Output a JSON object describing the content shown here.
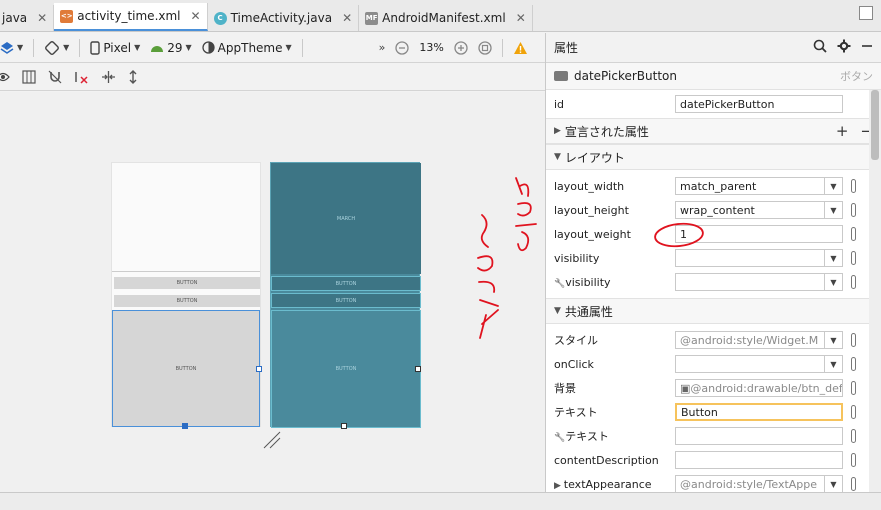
{
  "tabs": [
    {
      "label": "java",
      "icon": "java-file-icon"
    },
    {
      "label": "activity_time.xml",
      "icon": "xml-file-icon",
      "icon_text": "<>"
    },
    {
      "label": "TimeActivity.java",
      "icon": "java-class-icon",
      "icon_text": "C"
    },
    {
      "label": "AndroidManifest.xml",
      "icon": "manifest-file-icon",
      "icon_text": "MF"
    }
  ],
  "toolbar": {
    "device": "Pixel",
    "api": "29",
    "theme": "AppTheme",
    "overflow": "»",
    "zoom": "13%"
  },
  "canvas": {
    "screen1": {
      "button1": "BUTTON",
      "button2": "BUTTON",
      "button3": "BUTTON"
    },
    "screen2": {
      "top_label": "MARCH",
      "button1": "BUTTON",
      "button2": "BUTTON",
      "button3": "BUTTON"
    }
  },
  "props": {
    "title": "属性",
    "component": "datePickerButton",
    "component_kind": "ボタン",
    "id_label": "id",
    "id_value": "datePickerButton",
    "sections": {
      "declared": "宣言された属性",
      "layout": "レイアウト",
      "common": "共通属性"
    },
    "layout_rows": [
      {
        "label": "layout_width",
        "value": "match_parent",
        "dropdown": true
      },
      {
        "label": "layout_height",
        "value": "wrap_content",
        "dropdown": true
      },
      {
        "label": "layout_weight",
        "value": "1",
        "dropdown": false
      },
      {
        "label": "visibility",
        "value": "",
        "dropdown": true
      },
      {
        "label": "visibility",
        "value": "",
        "dropdown": true,
        "wrench": true
      }
    ],
    "common_rows": [
      {
        "label": "スタイル",
        "value": "@android:style/Widget.M",
        "dropdown": true,
        "gray": true
      },
      {
        "label": "onClick",
        "value": "",
        "dropdown": true
      },
      {
        "label": "背景",
        "value": "@android:drawable/btn_def",
        "dropdown": false,
        "gray": true,
        "image": true
      },
      {
        "label": "テキスト",
        "value": "Button",
        "dropdown": false,
        "highlight": true
      },
      {
        "label": "テキスト",
        "value": "",
        "dropdown": false,
        "wrench": true
      },
      {
        "label": "contentDescription",
        "value": "",
        "dropdown": false
      },
      {
        "label": "textAppearance",
        "value": "@android:style/TextAppe",
        "dropdown": true,
        "gray": true,
        "expand": true
      }
    ]
  },
  "colors": {
    "accent": "#4a90d9",
    "blueprint": "#4a8a9c",
    "annotation": "#e0131f",
    "highlight": "#f6c35c"
  }
}
